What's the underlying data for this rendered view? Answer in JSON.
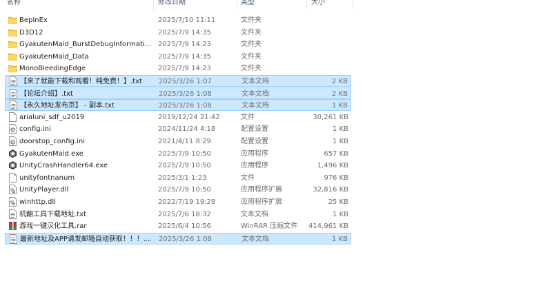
{
  "columns": {
    "name": "名称",
    "date": "修改日期",
    "type": "类型",
    "size": "大小"
  },
  "files": [
    {
      "name": "BepInEx",
      "date": "2025/7/10 11:11",
      "type": "文件夹",
      "size": "",
      "icon": "folder-icon",
      "selected": false
    },
    {
      "name": "D3D12",
      "date": "2025/7/9 14:35",
      "type": "文件夹",
      "size": "",
      "icon": "folder-icon",
      "selected": false
    },
    {
      "name": "GyakutenMaid_BurstDebugInformati...",
      "date": "2025/7/9 14:23",
      "type": "文件夹",
      "size": "",
      "icon": "folder-icon",
      "selected": false
    },
    {
      "name": "GyakutenMaid_Data",
      "date": "2025/7/9 14:35",
      "type": "文件夹",
      "size": "",
      "icon": "folder-icon",
      "selected": false
    },
    {
      "name": "MonoBleedingEdge",
      "date": "2025/7/9 14:23",
      "type": "文件夹",
      "size": "",
      "icon": "folder-icon",
      "selected": false
    },
    {
      "name": "【来了就能下载和观看！纯免费！】.txt",
      "date": "2025/3/26 1:07",
      "type": "文本文档",
      "size": "2 KB",
      "icon": "text-file-icon",
      "selected": true
    },
    {
      "name": "【论坛介绍】.txt",
      "date": "2025/3/26 1:08",
      "type": "文本文档",
      "size": "2 KB",
      "icon": "text-file-icon",
      "selected": true
    },
    {
      "name": "【永久地址发布页】 - 副本.txt",
      "date": "2025/3/26 1:08",
      "type": "文本文档",
      "size": "1 KB",
      "icon": "text-file-icon",
      "selected": true
    },
    {
      "name": "arialuni_sdf_u2019",
      "date": "2019/12/24 21:42",
      "type": "文件",
      "size": "30,261 KB",
      "icon": "blank-file-icon",
      "selected": false
    },
    {
      "name": "config.ini",
      "date": "2024/11/24 4:18",
      "type": "配置设置",
      "size": "1 KB",
      "icon": "config-file-icon",
      "selected": false
    },
    {
      "name": "doorstop_config.ini",
      "date": "2021/4/11 8:29",
      "type": "配置设置",
      "size": "1 KB",
      "icon": "config-file-icon",
      "selected": false
    },
    {
      "name": "GyakutenMaid.exe",
      "date": "2025/7/9 10:50",
      "type": "应用程序",
      "size": "657 KB",
      "icon": "unity-app-icon",
      "selected": false
    },
    {
      "name": "UnityCrashHandler64.exe",
      "date": "2025/7/9 10:50",
      "type": "应用程序",
      "size": "1,496 KB",
      "icon": "unity-app-icon",
      "selected": false
    },
    {
      "name": "unityfontnanum",
      "date": "2025/3/1 1:23",
      "type": "文件",
      "size": "976 KB",
      "icon": "blank-file-icon",
      "selected": false
    },
    {
      "name": "UnityPlayer.dll",
      "date": "2025/7/9 10:50",
      "type": "应用程序扩展",
      "size": "32,816 KB",
      "icon": "dll-file-icon",
      "selected": false
    },
    {
      "name": "winhttp.dll",
      "date": "2022/7/19 19:28",
      "type": "应用程序扩展",
      "size": "25 KB",
      "icon": "dll-file-icon",
      "selected": false
    },
    {
      "name": "机翻工具下载地址.txt",
      "date": "2025/7/6 18:32",
      "type": "文本文档",
      "size": "1 KB",
      "icon": "text-file-icon",
      "selected": false
    },
    {
      "name": "游戏一键汉化工具.rar",
      "date": "2025/6/4 10:56",
      "type": "WinRAR 压缩文件",
      "size": "414,961 KB",
      "icon": "winrar-archive-icon",
      "selected": false
    },
    {
      "name": "最新地址及APP请发邮箱自动获取！！！....",
      "date": "2025/3/26 1:08",
      "type": "文本文档",
      "size": "1 KB",
      "icon": "text-file-icon",
      "selected": true
    }
  ],
  "colors": {
    "selection_bg": "#cce8ff",
    "selection_border": "#99d1ff",
    "folder": "#f7c34c",
    "header_text": "#4c607a"
  }
}
